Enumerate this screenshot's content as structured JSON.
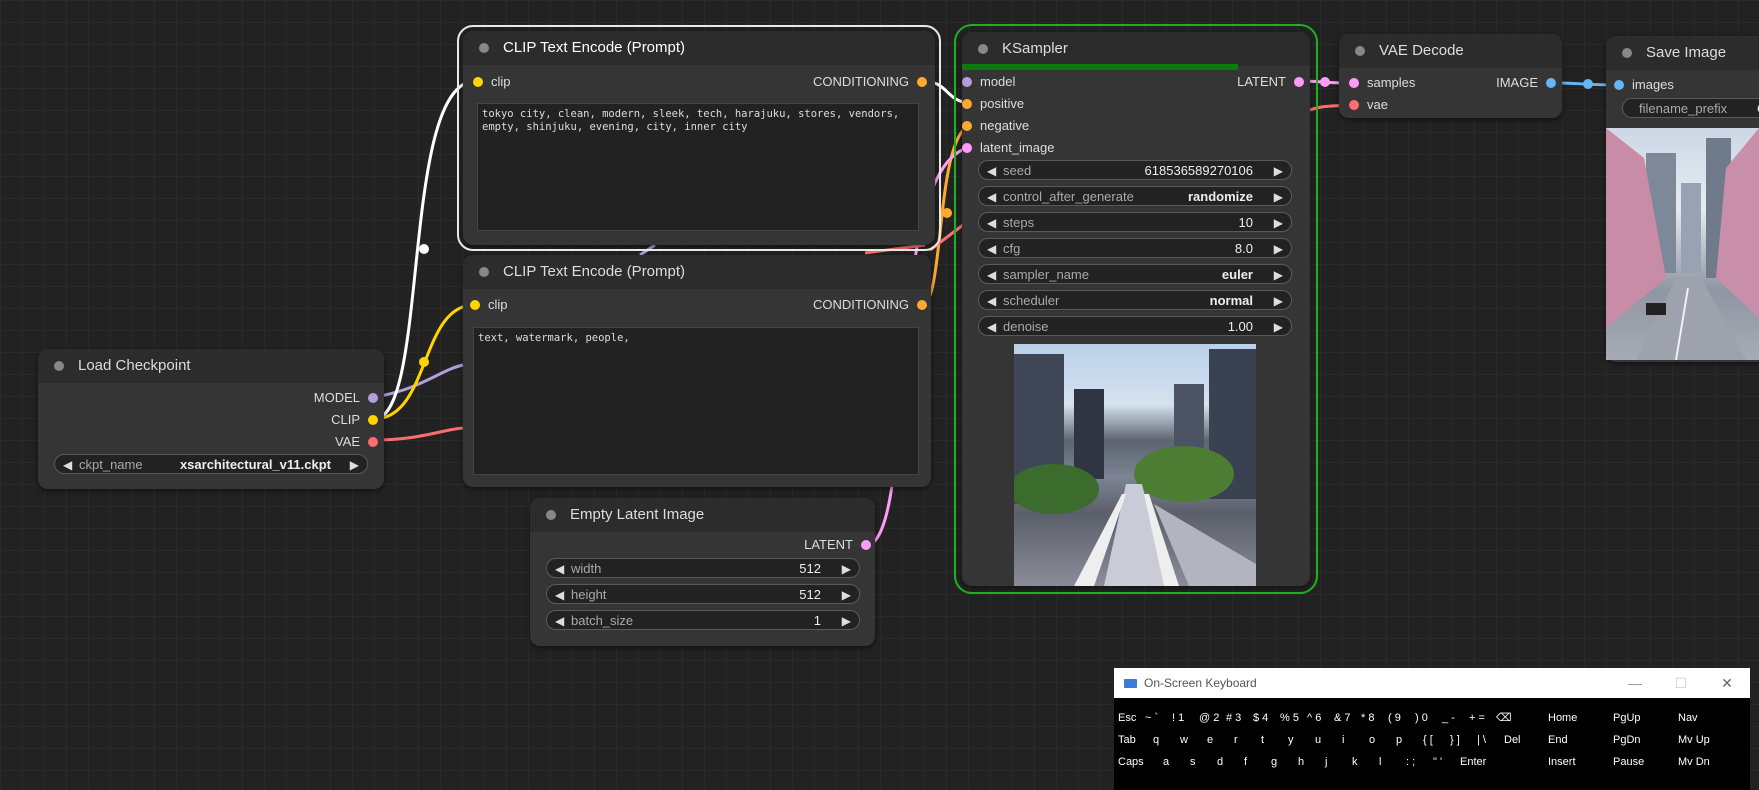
{
  "nodes": {
    "clip_pos": {
      "title": "CLIP Text Encode (Prompt)",
      "input_clip": "clip",
      "output": "CONDITIONING",
      "text": "tokyo city, clean, modern, sleek, tech, harajuku, stores, vendors,\nempty, shinjuku, evening, city, inner city"
    },
    "clip_neg": {
      "title": "CLIP Text Encode (Prompt)",
      "input_clip": "clip",
      "output": "CONDITIONING",
      "text": "text, watermark, people,"
    },
    "load_checkpoint": {
      "title": "Load Checkpoint",
      "out_model": "MODEL",
      "out_clip": "CLIP",
      "out_vae": "VAE",
      "ckpt_label": "ckpt_name",
      "ckpt_value": "xsarchitectural_v11.ckpt"
    },
    "empty_latent": {
      "title": "Empty Latent Image",
      "output": "LATENT",
      "widgets": [
        {
          "label": "width",
          "value": "512"
        },
        {
          "label": "height",
          "value": "512"
        },
        {
          "label": "batch_size",
          "value": "1"
        }
      ]
    },
    "ksampler": {
      "title": "KSampler",
      "progress": 1.0,
      "inputs": [
        "model",
        "positive",
        "negative",
        "latent_image"
      ],
      "output": "LATENT",
      "widgets": [
        {
          "label": "seed",
          "value": "618536589270106"
        },
        {
          "label": "control_after_generate",
          "value": "randomize"
        },
        {
          "label": "steps",
          "value": "10"
        },
        {
          "label": "cfg",
          "value": "8.0"
        },
        {
          "label": "sampler_name",
          "value": "euler"
        },
        {
          "label": "scheduler",
          "value": "normal"
        },
        {
          "label": "denoise",
          "value": "1.00"
        }
      ]
    },
    "vae_decode": {
      "title": "VAE Decode",
      "in_samples": "samples",
      "in_vae": "vae",
      "output": "IMAGE"
    },
    "save_image": {
      "title": "Save Image",
      "in_images": "images",
      "prefix_label": "filename_prefix",
      "prefix_value": "C"
    }
  },
  "keyboard": {
    "title": "On-Screen Keyboard",
    "row1": [
      "Esc",
      "~ `",
      "! 1",
      "@ 2",
      "# 3",
      "$ 4",
      "% 5",
      "^ 6",
      "& 7",
      "* 8",
      "( 9",
      ") 0",
      "_ -",
      "+ =",
      "⌫"
    ],
    "row2": [
      "Tab",
      "q",
      "w",
      "e",
      "r",
      "t",
      "y",
      "u",
      "i",
      "o",
      "p",
      "{ [",
      "} ]",
      "| \\",
      "Del"
    ],
    "row3": [
      "Caps",
      "a",
      "s",
      "d",
      "f",
      "g",
      "h",
      "j",
      "k",
      "l",
      ": ;",
      "\" '",
      "Enter"
    ],
    "nav1": [
      "Home",
      "PgUp",
      "Nav"
    ],
    "nav2": [
      "End",
      "PgDn",
      "Mv Up"
    ],
    "nav3": [
      "Insert",
      "Pause",
      "Mv Dn"
    ]
  },
  "colors": {
    "clip": "#ffd500",
    "model": "#b39ddb",
    "vae": "#ff6e6e",
    "conditioning": "#ffa931",
    "latent": "#ff9cf9",
    "image": "#64b5f6"
  }
}
